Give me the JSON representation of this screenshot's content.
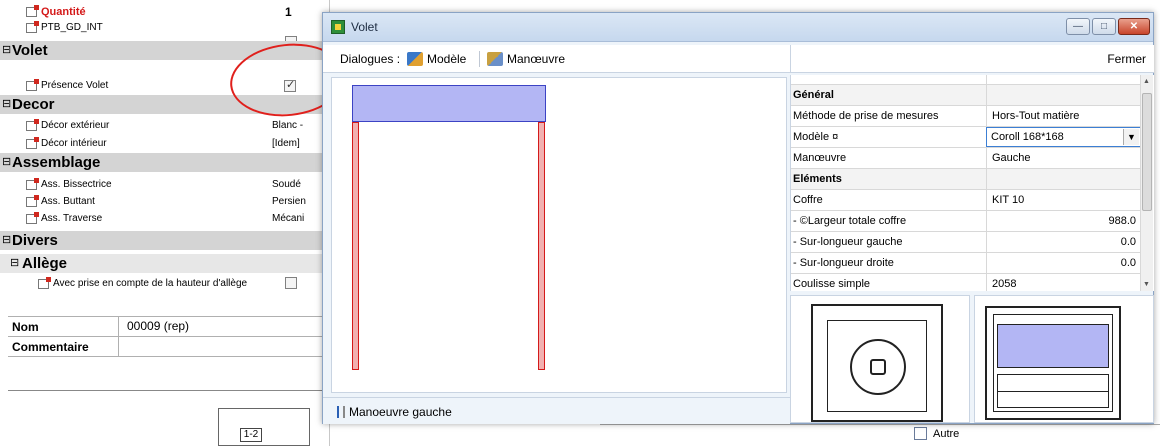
{
  "background_panel": {
    "rows": {
      "quantite": {
        "label": "Quantité",
        "value": "1"
      },
      "ptb": {
        "label": "PTB_GD_INT"
      },
      "presence_volet": {
        "label": "Présence Volet"
      },
      "decor_ext": {
        "label": "Décor extérieur",
        "value": "Blanc -"
      },
      "decor_int": {
        "label": "Décor intérieur",
        "value": "[Idem]"
      },
      "ass_bis": {
        "label": "Ass. Bissectrice",
        "value": "Soudé"
      },
      "ass_butt": {
        "label": "Ass. Buttant",
        "value": "Persien"
      },
      "ass_trav": {
        "label": "Ass. Traverse",
        "value": "Mécani"
      },
      "allege_opt": {
        "label": "Avec prise en compte de la hauteur d'allège"
      }
    },
    "groups": {
      "volet": "Volet",
      "decor": "Decor",
      "assemblage": "Assemblage",
      "divers": "Divers",
      "allege": "Allège"
    },
    "info": {
      "nom_label": "Nom",
      "nom_value": "00009 (rep)",
      "commentaire_label": "Commentaire"
    },
    "drawing_tag": "1-2",
    "autre_label": "Autre"
  },
  "window": {
    "title": "Volet",
    "toolbar": {
      "dialogues_label": "Dialogues :",
      "modele_label": "Modèle",
      "manoeuvre_label": "Manœuvre"
    },
    "fermer_label": "Fermer",
    "status_text": "Manoeuvre gauche",
    "properties": {
      "general_header": "Général",
      "methode_label": "Méthode de prise de mesures",
      "methode_value": "Hors-Tout matière",
      "modele_label": "Modèle ¤",
      "modele_value": "Coroll 168*168",
      "manoeuvre_label": "Manœuvre",
      "manoeuvre_value": "Gauche",
      "elements_header": "Eléments",
      "coffre_label": "Coffre",
      "coffre_value": "KIT 10",
      "largeur_label": "- ©Largeur totale coffre",
      "largeur_value": "988.0",
      "sur_gauche_label": "- Sur-longueur gauche",
      "sur_gauche_value": "0.0",
      "sur_droite_label": "- Sur-longueur droite",
      "sur_droite_value": "0.0",
      "coulisse_label": "Coulisse simple",
      "coulisse_value": "2058"
    }
  },
  "colors": {
    "coffre_fill": "#b3b6f4",
    "coulisse_fill": "#f2b1b1",
    "highlight_ellipse": "#e0201c",
    "quantite_label": "#d41a1a"
  }
}
